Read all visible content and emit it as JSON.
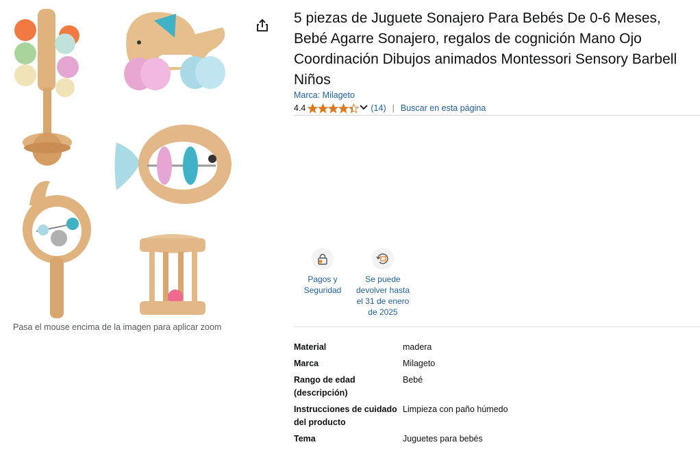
{
  "product": {
    "title": "5 piezas de Juguete Sonajero Para Bebés De 0-6 Meses, Bebé Agarre Sonajero, regalos de cognición Mano Ojo Coordinación Dibujos animados Montessori Sensory Barbell Niños",
    "brand_link": "Marca: Milageto",
    "rating_value": "4.4",
    "rating_stars": 4.4,
    "rating_count": "(14)",
    "search_page_link": "Buscar en esta página",
    "separator": "|"
  },
  "gallery": {
    "zoom_hint": "Pasa el mouse encima de la imagen para aplicar zoom"
  },
  "features": [
    {
      "label": "Pagos y Seguridad",
      "icon": "lock-icon"
    },
    {
      "label": "Se puede devolver hasta el 31 de enero de 2025",
      "icon": "return-box-icon"
    }
  ],
  "specs": [
    {
      "key": "Material",
      "value": "madera"
    },
    {
      "key": "Marca",
      "value": "Milageto"
    },
    {
      "key": "Rango de edad (descripción)",
      "value": "Bebé"
    },
    {
      "key": "Instrucciones de cuidado del producto",
      "value": "Limpieza con paño húmedo"
    },
    {
      "key": "Tema",
      "value": "Juguetes para bebés"
    }
  ],
  "colors": {
    "link": "#2162a1",
    "star": "#de7921",
    "text": "#0f1111",
    "muted": "#565959",
    "wood": "#e3b889"
  }
}
